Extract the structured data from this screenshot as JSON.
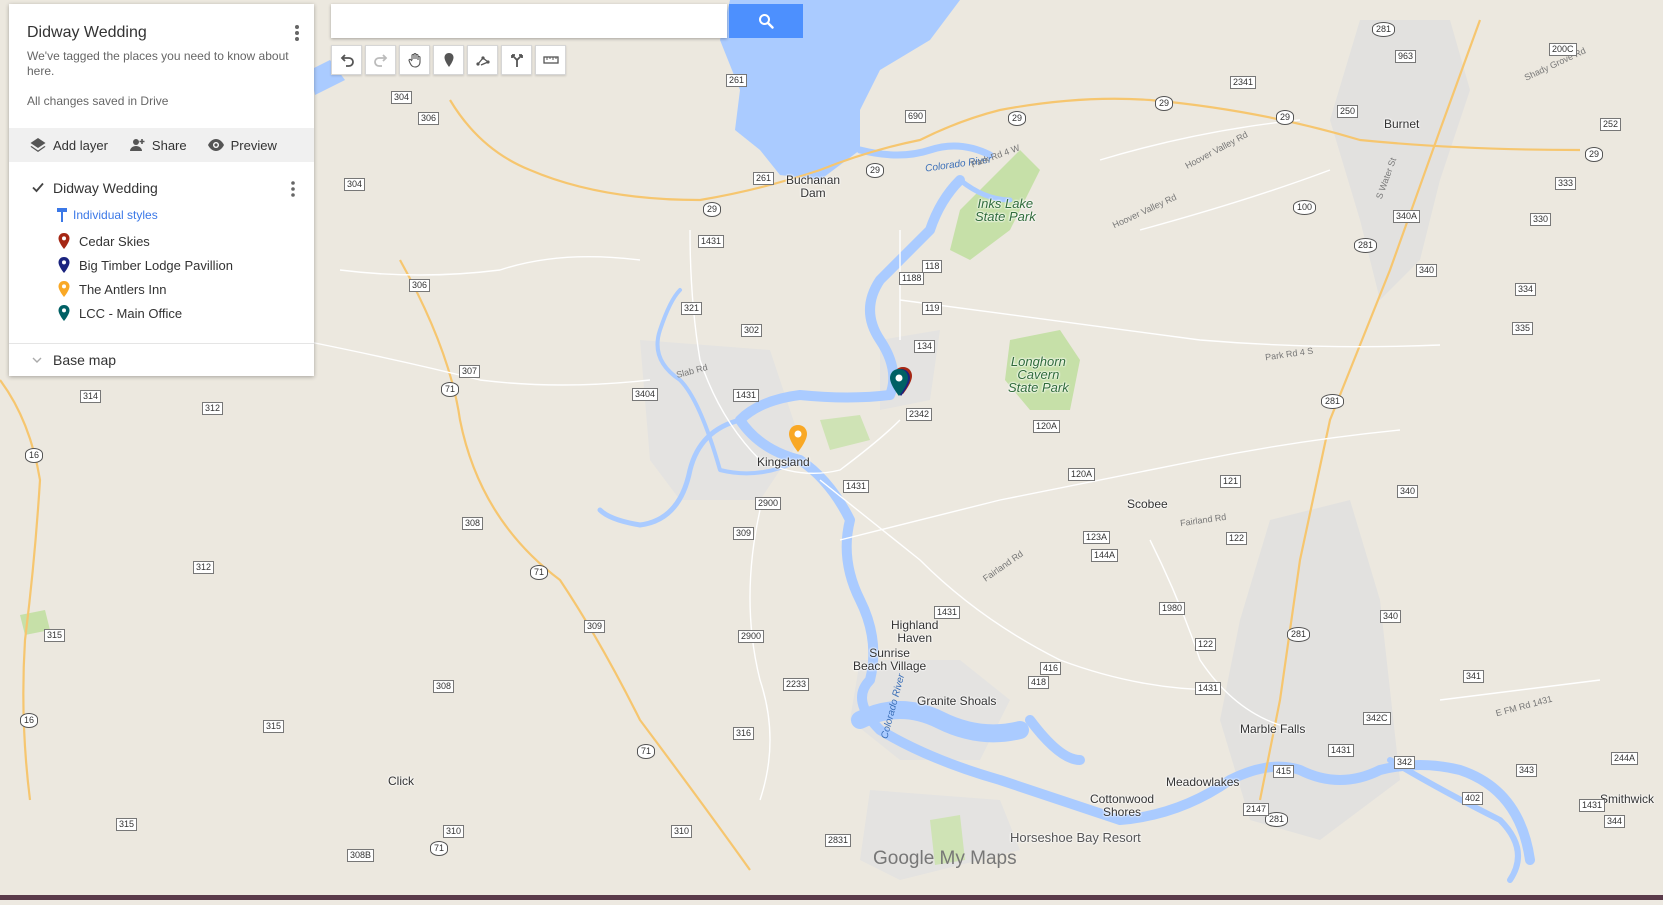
{
  "search": {
    "placeholder": "",
    "value": ""
  },
  "toolbar": [
    {
      "name": "undo-button",
      "icon": "undo-icon"
    },
    {
      "name": "redo-button",
      "icon": "redo-icon"
    },
    {
      "name": "select-items-button",
      "icon": "hand-icon"
    },
    {
      "name": "add-marker-button",
      "icon": "marker-icon"
    },
    {
      "name": "draw-line-button",
      "icon": "draw-line-icon"
    },
    {
      "name": "add-directions-button",
      "icon": "directions-icon"
    },
    {
      "name": "measure-button",
      "icon": "ruler-icon"
    }
  ],
  "panel": {
    "title": "Didway Wedding",
    "description": "We've tagged the places you need to know about here.",
    "saved_status": "All changes saved in Drive",
    "actions": {
      "add_layer": "Add layer",
      "share": "Share",
      "preview": "Preview"
    },
    "layer": {
      "name": "Didway Wedding",
      "checked": true,
      "styles_link": "Individual styles",
      "places": [
        {
          "label": "Cedar Skies",
          "color": "#a52714"
        },
        {
          "label": "Big Timber Lodge Pavillion",
          "color": "#1a237e"
        },
        {
          "label": "The Antlers Inn",
          "color": "#f9a825"
        },
        {
          "label": "LCC - Main Office",
          "color": "#006064"
        }
      ]
    },
    "base_map": "Base map"
  },
  "map": {
    "towns": {
      "burnet": "Burnet",
      "buchanan_dam": "Buchanan\nDam",
      "kingsland": "Kingsland",
      "scobee": "Scobee",
      "highland_haven": "Highland\nHaven",
      "sunrise_beach": "Sunrise\nBeach Village",
      "granite_shoals": "Granite Shoals",
      "marble_falls": "Marble Falls",
      "meadowlakes": "Meadowlakes",
      "cottonwood_shores": "Cottonwood\nShores",
      "click": "Click",
      "smithwick": "Smithwick"
    },
    "parks": {
      "inks_lake": "Inks Lake\nState Park",
      "longhorn": "Longhorn\nCavern\nState Park"
    },
    "poi": {
      "horseshoe_bay": "Horseshoe Bay Resort"
    },
    "rivers": {
      "colorado_1": "Colorado River",
      "colorado_2": "Colorado River"
    },
    "roads": {
      "park_rd_4w": "Park Rd 4 W",
      "park_rd_4s": "Park Rd 4 S",
      "hoover_valley_rd": "Hoover Valley Rd",
      "hoover_valley_rd_2": "Hoover Valley Rd",
      "slab_rd": "Slab Rd",
      "fairland_rd": "Fairland Rd",
      "fairland_rd_2": "Fairland Rd",
      "s_water_st": "S Water St",
      "shady_grove_rd": "Shady Grove Rd",
      "e_fm_rd_1431": "E FM Rd 1431"
    },
    "shields": [
      "281",
      "963",
      "200C",
      "2341",
      "690",
      "29",
      "29",
      "29",
      "29",
      "250",
      "252",
      "304",
      "306",
      "261",
      "261",
      "29",
      "29",
      "333",
      "304",
      "100",
      "340A",
      "330",
      "1431",
      "118",
      "1188",
      "281",
      "340",
      "306",
      "321",
      "119",
      "334",
      "302",
      "134",
      "335",
      "307",
      "71",
      "3404",
      "1431",
      "2342",
      "120A",
      "281",
      "314",
      "312",
      "16",
      "120A",
      "121",
      "1431",
      "340",
      "2900",
      "123A",
      "309",
      "144A",
      "122",
      "308",
      "71",
      "312",
      "1980",
      "1431",
      "281",
      "340",
      "315",
      "309",
      "2900",
      "122",
      "416",
      "418",
      "1431",
      "341",
      "2233",
      "308",
      "16",
      "315",
      "316",
      "71",
      "342C",
      "342",
      "1431",
      "415",
      "402",
      "244A",
      "343",
      "281",
      "2147",
      "1431",
      "344",
      "315",
      "310",
      "310",
      "2831",
      "308B",
      "71"
    ],
    "brand": {
      "google": "Google",
      "my_maps": " My Maps"
    }
  }
}
